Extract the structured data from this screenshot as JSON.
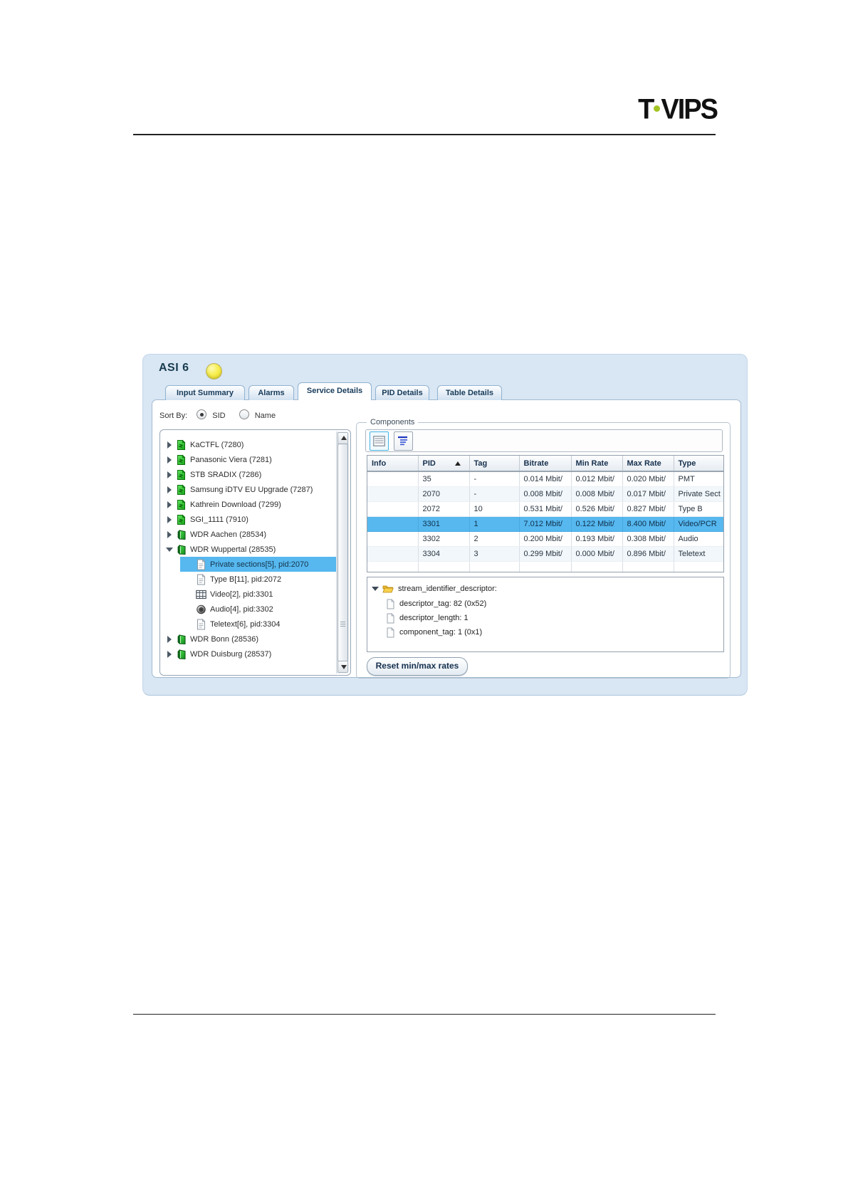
{
  "logo": {
    "prefix": "T",
    "suffix": "VIPS",
    "dot_color": "#a4c424"
  },
  "window": {
    "title": "ASI 6",
    "status_icon": "yellow-status-lamp",
    "active_tab": "Service Details",
    "tabs": [
      {
        "label": "Input Summary"
      },
      {
        "label": "Alarms"
      },
      {
        "label": "Service Details"
      },
      {
        "label": "PID Details"
      },
      {
        "label": "Table Details"
      }
    ]
  },
  "sort_by": {
    "label": "Sort By:",
    "options": [
      "SID",
      "Name"
    ],
    "selected": "SID"
  },
  "tree": {
    "items": [
      {
        "label": "KaCTFL (7280)",
        "icon": "scrambled-service-icon",
        "state": "collapsed",
        "depth": 0,
        "selected": false
      },
      {
        "label": "Panasonic Viera (7281)",
        "icon": "scrambled-service-icon",
        "state": "collapsed",
        "depth": 0,
        "selected": false
      },
      {
        "label": "STB SRADIX (7286)",
        "icon": "scrambled-service-icon",
        "state": "collapsed",
        "depth": 0,
        "selected": false
      },
      {
        "label": "Samsung iDTV EU Upgrade (7287)",
        "icon": "scrambled-service-icon",
        "state": "collapsed",
        "depth": 0,
        "selected": false
      },
      {
        "label": "Kathrein Download (7299)",
        "icon": "scrambled-service-icon",
        "state": "collapsed",
        "depth": 0,
        "selected": false
      },
      {
        "label": "SGI_1111 (7910)",
        "icon": "scrambled-service-icon",
        "state": "collapsed",
        "depth": 0,
        "selected": false
      },
      {
        "label": "WDR Aachen (28534)",
        "icon": "service-icon",
        "state": "collapsed",
        "depth": 0,
        "selected": false
      },
      {
        "label": "WDR Wuppertal (28535)",
        "icon": "service-icon",
        "state": "expanded",
        "depth": 0,
        "selected": false
      },
      {
        "label": "Private sections[5], pid:2070",
        "icon": "sections-icon",
        "state": "leaf",
        "depth": 1,
        "selected": true
      },
      {
        "label": "Type B[11], pid:2072",
        "icon": "sections-icon",
        "state": "leaf",
        "depth": 1,
        "selected": false
      },
      {
        "label": "Video[2], pid:3301",
        "icon": "video-icon",
        "state": "leaf",
        "depth": 1,
        "selected": false
      },
      {
        "label": "Audio[4], pid:3302",
        "icon": "audio-icon",
        "state": "leaf",
        "depth": 1,
        "selected": false
      },
      {
        "label": "Teletext[6], pid:3304",
        "icon": "sections-icon",
        "state": "leaf",
        "depth": 1,
        "selected": false
      },
      {
        "label": "WDR Bonn (28536)",
        "icon": "service-icon",
        "state": "collapsed",
        "depth": 0,
        "selected": false
      },
      {
        "label": "WDR Duisburg (28537)",
        "icon": "service-icon",
        "state": "collapsed",
        "depth": 0,
        "selected": false
      }
    ]
  },
  "components": {
    "legend": "Components",
    "toolbar": {
      "buttons": [
        {
          "name": "list-view",
          "selected": true
        },
        {
          "name": "tree-view",
          "selected": false
        }
      ]
    },
    "table": {
      "columns": [
        "Info",
        "PID",
        "Tag",
        "Bitrate",
        "Min Rate",
        "Max Rate",
        "Type"
      ],
      "sort": {
        "column": "PID",
        "direction": "ascending"
      },
      "rows": [
        {
          "info": "",
          "pid": "35",
          "tag": "-",
          "bitrate": "0.014 Mbit/",
          "min_rate": "0.012 Mbit/",
          "max_rate": "0.020 Mbit/",
          "type": "PMT",
          "selected": false
        },
        {
          "info": "",
          "pid": "2070",
          "tag": "-",
          "bitrate": "0.008 Mbit/",
          "min_rate": "0.008 Mbit/",
          "max_rate": "0.017 Mbit/",
          "type": "Private Sect",
          "selected": false
        },
        {
          "info": "",
          "pid": "2072",
          "tag": "10",
          "bitrate": "0.531 Mbit/",
          "min_rate": "0.526 Mbit/",
          "max_rate": "0.827 Mbit/",
          "type": "Type B",
          "selected": false
        },
        {
          "info": "",
          "pid": "3301",
          "tag": "1",
          "bitrate": "7.012 Mbit/",
          "min_rate": "0.122 Mbit/",
          "max_rate": "8.400 Mbit/",
          "type": "Video/PCR",
          "selected": true
        },
        {
          "info": "",
          "pid": "3302",
          "tag": "2",
          "bitrate": "0.200 Mbit/",
          "min_rate": "0.193 Mbit/",
          "max_rate": "0.308 Mbit/",
          "type": "Audio",
          "selected": false
        },
        {
          "info": "",
          "pid": "3304",
          "tag": "3",
          "bitrate": "0.299 Mbit/",
          "min_rate": "0.000 Mbit/",
          "max_rate": "0.896 Mbit/",
          "type": "Teletext",
          "selected": false
        }
      ]
    },
    "descriptor": {
      "root": "stream_identifier_descriptor:",
      "children": [
        "descriptor_tag: 82 (0x52)",
        "descriptor_length: 1",
        "component_tag: 1 (0x1)"
      ]
    },
    "reset_button": "Reset min/max rates"
  }
}
